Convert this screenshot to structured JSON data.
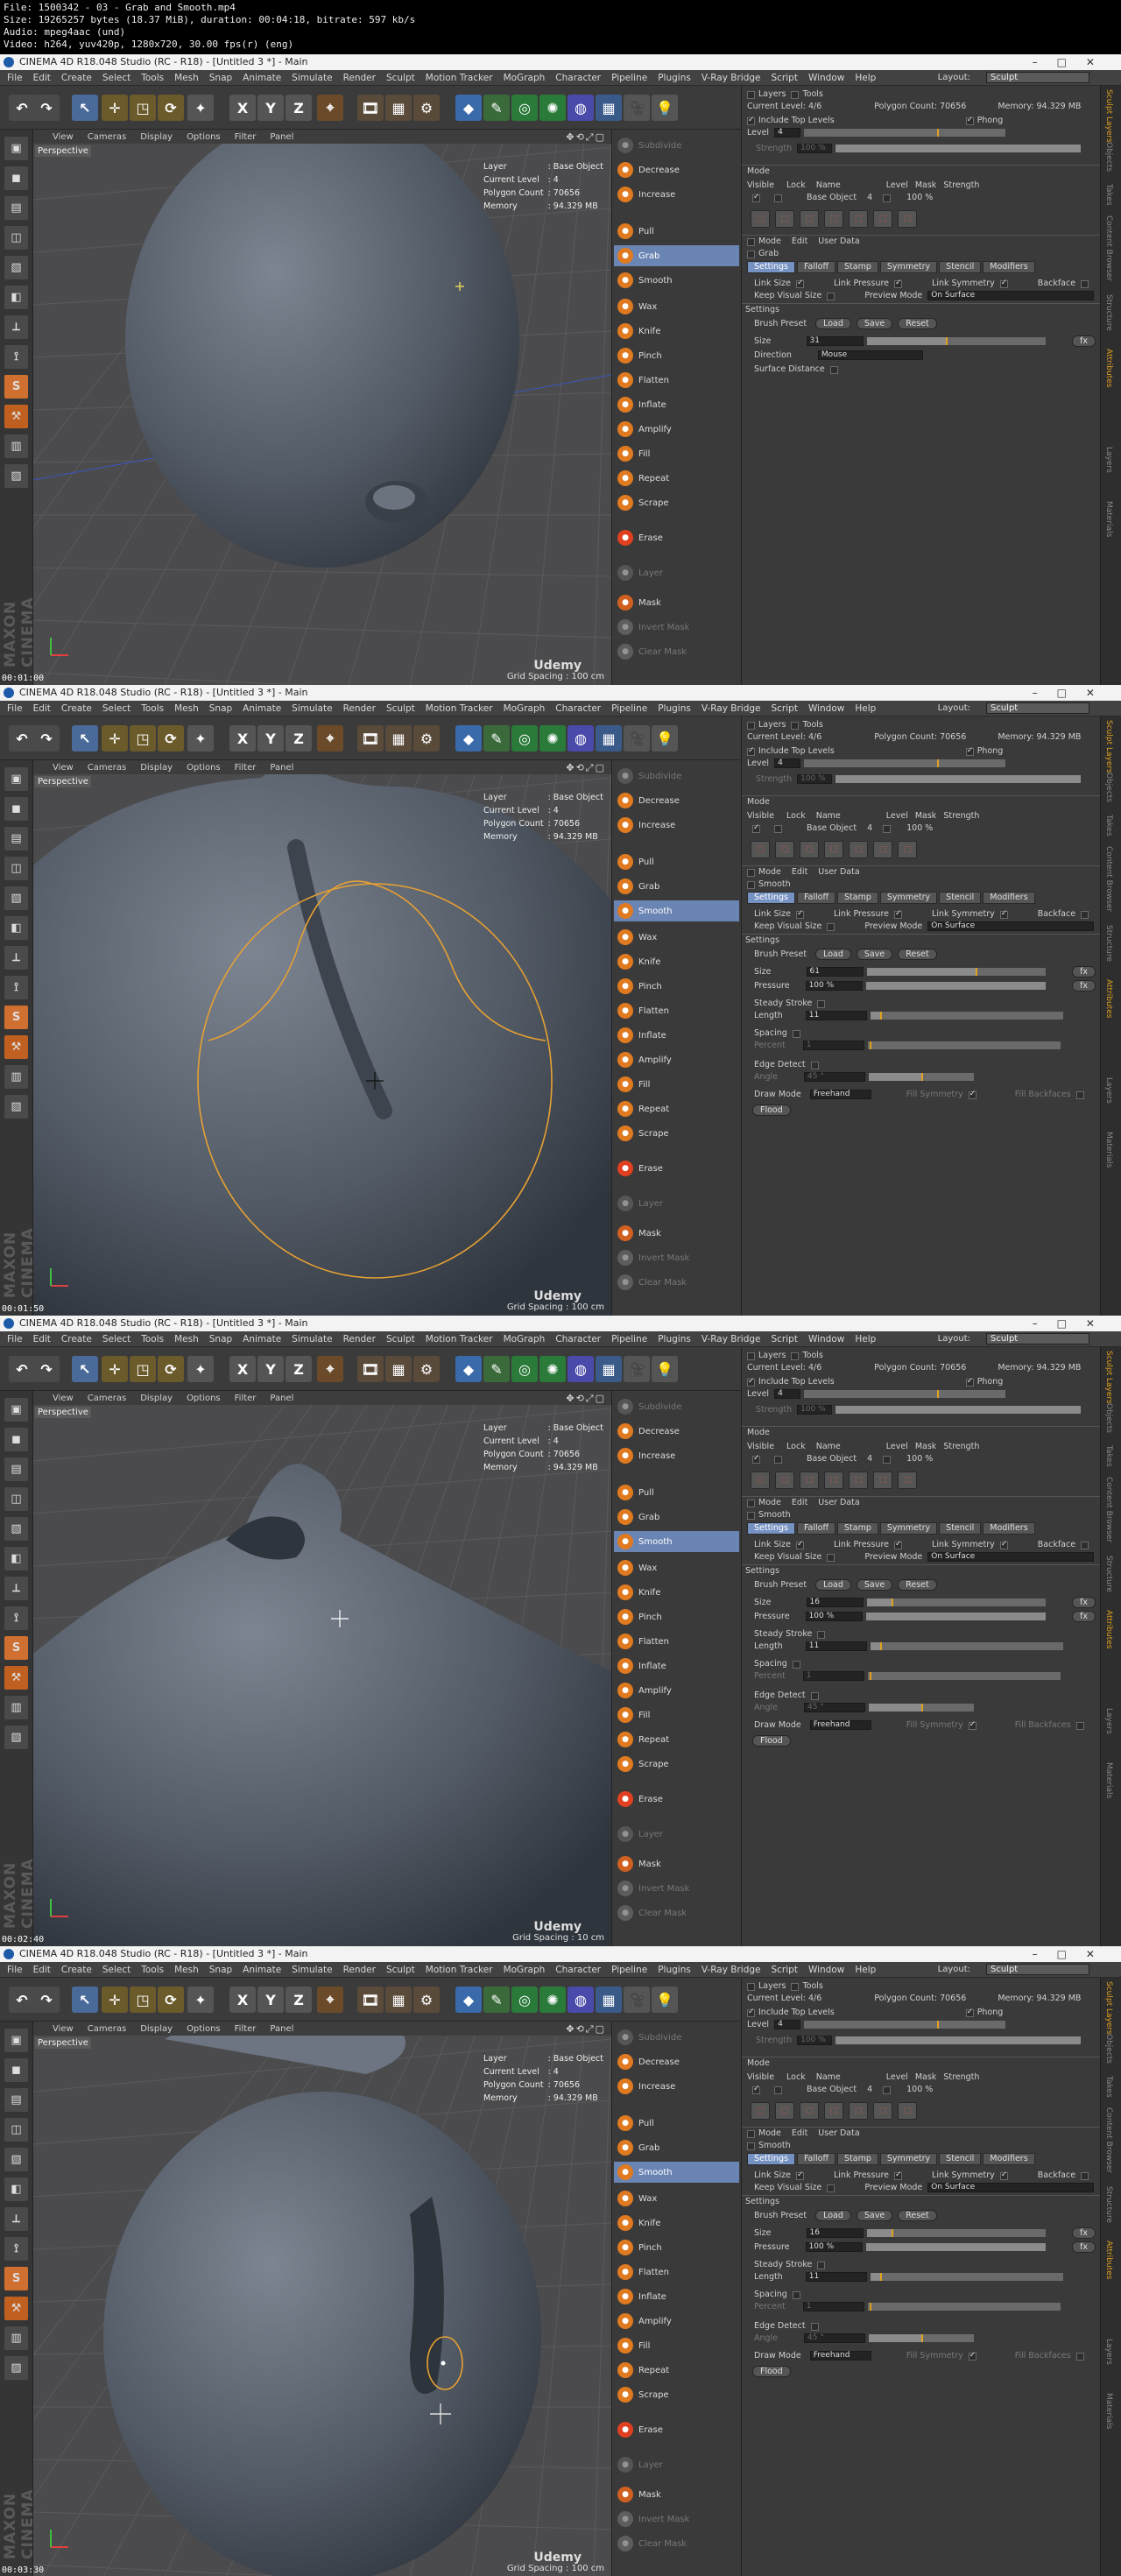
{
  "file_info": [
    "File: 1500342 - 03 - Grab and Smooth.mp4",
    "Size: 19265257 bytes (18.37 MiB), duration: 00:04:18, bitrate: 597 kb/s",
    "Audio: mpeg4aac (und)",
    "Video: h264, yuv420p, 1280x720, 30.00 fps(r) (eng)"
  ],
  "app": {
    "title": "CINEMA 4D R18.048 Studio (RC - R18) - [Untitled 3 *] - Main",
    "menu": [
      "File",
      "Edit",
      "Create",
      "Select",
      "Tools",
      "Mesh",
      "Snap",
      "Animate",
      "Simulate",
      "Render",
      "Sculpt",
      "Motion Tracker",
      "MoGraph",
      "Character",
      "Pipeline",
      "Plugins",
      "V-Ray Bridge",
      "Script",
      "Window",
      "Help"
    ],
    "layout_label": "Layout:",
    "layout_value": "Sculpt",
    "viewport_menu": [
      "View",
      "Cameras",
      "Display",
      "Options",
      "Filter",
      "Panel"
    ],
    "viewport_name": "Perspective",
    "hud_labels": [
      "Layer",
      "Current Level",
      "Polygon Count",
      "Memory"
    ],
    "hud_values": [
      ": Base Object",
      ": 4",
      ": 70656",
      ": 94.329 MB"
    ],
    "udemy": "Udemy",
    "maxon": "MAXON CINEMA 4D"
  },
  "toolbar_icons": [
    "undo",
    "redo",
    "live-select",
    "move",
    "scale",
    "rotate",
    "recent-tool",
    "x-axis",
    "y-axis",
    "z-axis",
    "coordinate-system",
    "render-view",
    "render-region",
    "render-settings",
    "cube",
    "pen",
    "subdivision",
    "array",
    "deformer",
    "floor",
    "camera",
    "light"
  ],
  "brushes": [
    "Subdivide",
    "Decrease",
    "Increase",
    "Pull",
    "Grab",
    "Smooth",
    "Wax",
    "Knife",
    "Pinch",
    "Flatten",
    "Inflate",
    "Amplify",
    "Fill",
    "Repeat",
    "Scrape",
    "Erase",
    "Layer",
    "Mask",
    "Invert Mask",
    "Clear Mask"
  ],
  "attr": {
    "tabs_top": [
      "Layers",
      "Tools"
    ],
    "current_level": "Current Level: 4/6",
    "polygon_count": "Polygon Count: 70656",
    "memory": "Memory: 94.329 MB",
    "include_top": "Include Top Levels",
    "phong": "Phong",
    "level_label": "Level",
    "level_value": "4",
    "strength_label": "Strength",
    "strength_value": "100 %",
    "mode_label": "Mode",
    "table_headers": [
      "Visible",
      "Lock",
      "Name",
      "Level",
      "Mask",
      "Strength"
    ],
    "table_row_name": "Base Object",
    "table_row_level": "4",
    "table_row_strength": "100 %",
    "attr_menu": [
      "Mode",
      "Edit",
      "User Data"
    ],
    "subtabs": [
      "Settings",
      "Falloff",
      "Stamp",
      "Symmetry",
      "Stencil",
      "Modifiers"
    ],
    "link_size": "Link Size",
    "link_pressure": "Link Pressure",
    "link_symmetry": "Link Symmetry",
    "backface": "Backface",
    "keep_visual": "Keep Visual Size",
    "preview_mode": "Preview Mode",
    "preview_value": "On Surface",
    "settings": "Settings",
    "brush_preset": "Brush Preset",
    "load": "Load",
    "save": "Save",
    "reset": "Reset",
    "size_label": "Size",
    "direction_label": "Direction",
    "direction_value": "Mouse",
    "surface_distance": "Surface Distance",
    "pressure_label": "Pressure",
    "pressure_value": "100 %",
    "steady_stroke": "Steady Stroke",
    "length_label": "Length",
    "length_value": "11",
    "spacing_label": "Spacing",
    "percent_label": "Percent",
    "percent_value": "1",
    "edge_detect": "Edge Detect",
    "angle_label": "Angle",
    "angle_value": "45 °",
    "draw_mode": "Draw Mode",
    "draw_mode_value": "Freehand",
    "fill_symmetry": "Fill Symmetry",
    "fill_backfaces": "Fill Backfaces",
    "flood": "Flood"
  },
  "right_strip": [
    "Sculpt Layers",
    "Objects",
    "Takes",
    "Content Browser",
    "Structure",
    "Attributes",
    "Layers",
    "Materials"
  ],
  "frames": [
    {
      "tool": "Grab",
      "brush_size": "31",
      "brush_size_fraction": 0.44,
      "timecode": "00:01:00",
      "grid_spacing": "Grid Spacing : 100 cm"
    },
    {
      "tool": "Smooth",
      "brush_size": "61",
      "brush_size_fraction": 0.61,
      "timecode": "00:01:50",
      "grid_spacing": "Grid Spacing : 100 cm"
    },
    {
      "tool": "Smooth",
      "brush_size": "16",
      "brush_size_fraction": 0.14,
      "timecode": "00:02:40",
      "grid_spacing": "Grid Spacing : 10 cm"
    },
    {
      "tool": "Smooth",
      "brush_size": "16",
      "brush_size_fraction": 0.14,
      "timecode": "00:03:30",
      "grid_spacing": "Grid Spacing : 100 cm"
    }
  ]
}
